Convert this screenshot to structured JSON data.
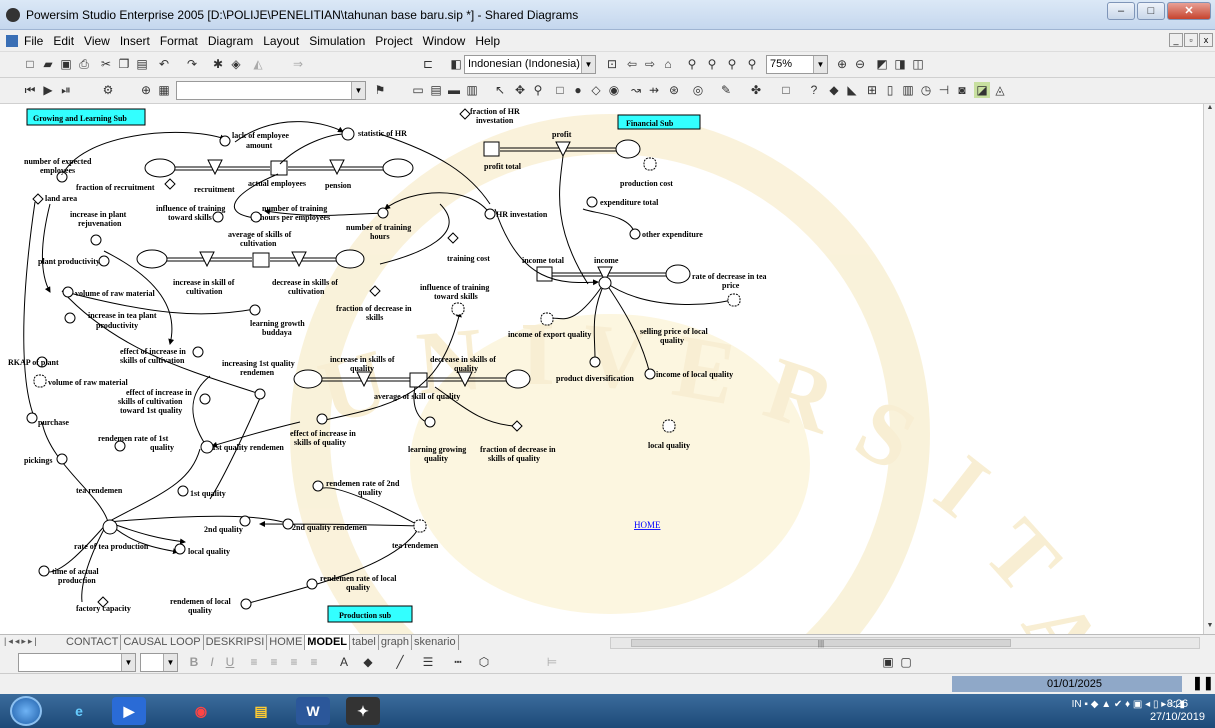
{
  "window": {
    "title": "Powersim Studio Enterprise 2005 [D:\\POLIJE\\PENELITIAN\\tahunan base baru.sip *] - Shared Diagrams"
  },
  "menu": [
    "File",
    "Edit",
    "View",
    "Insert",
    "Format",
    "Diagram",
    "Layout",
    "Simulation",
    "Project",
    "Window",
    "Help"
  ],
  "toolbar": {
    "language": "Indonesian (Indonesia)",
    "zoom": "75%"
  },
  "sectors": {
    "growing": "Growing and Learning Sub",
    "financial": "Financial Sub",
    "production": "Production sub"
  },
  "link": {
    "home": "HOME"
  },
  "labels": {
    "lack_of_employee": "lack of employee",
    "amount": "amount",
    "statistic_hr": "statistic of HR",
    "number_expected": "number of expected",
    "employees": "employees",
    "fraction_recruitment": "fraction of recruitment",
    "recruitment": "recruitment",
    "actual_employees": "actual employees",
    "pension": "pension",
    "land_area": "land area",
    "incr_plant": "increase in plant",
    "rejuvenation": "rejuvenation",
    "infl_training": "influence of training",
    "toward_skills": "toward skills",
    "num_training_hpe": "number of training",
    "hours_per_emp": "hours per employees",
    "avg_skills": "average of skills of",
    "cultivation": "cultivation",
    "num_training_hours": "number of training",
    "hours": "hours",
    "plant_productivity": "plant productivity",
    "training_cost": "training cost",
    "incr_skill_cult": "increase in skill of",
    "decr_skills": "decrease in skills of",
    "volume_raw": "volume of raw material",
    "incr_tea_plant": "increase in tea plant",
    "productivity": "productivity",
    "frac_decr_skills": "fraction of decrease in",
    "skills": "skills",
    "learning_growth": "learning growth",
    "buddaya": "buddaya",
    "effect_incr_skills": "effect of increase in",
    "skills_cult": "skills of cultivation",
    "rkap": "RKAP of plant",
    "increasing_1st": "increasing 1st quality",
    "rendemen": "rendemen",
    "volume_raw2": "volume of raw material",
    "effect_incr_skills2": "effect of increase in",
    "skills_cult2": "skills of cultivation",
    "toward_1st": "toward 1st quality",
    "purchase": "purchase",
    "rendemen_rate_1st": "rendemen rate of 1st",
    "quality": "quality",
    "pickings": "pickings",
    "first_quality_rendemen": "1st quality rendemen",
    "tea_rendemen": "tea rendemen",
    "first_quality": "1st quality",
    "rendemen_rate_2nd": "rendemen rate of 2nd",
    "quality2": "quality",
    "second_quality": "2nd quality",
    "second_quality_rendemen": "2nd quality rendemen",
    "tea_rendemen2": "tea rendemen",
    "rate_tea_prod": "rate of tea production",
    "local_quality": "local quality",
    "time_actual": "time of actual",
    "production": "production",
    "rendemen_rate_local": "rendemen rate of local",
    "quality3": "quality",
    "rendemen_local": "rendemen of local",
    "quality4": "quality",
    "factory_capacity": "factory capacity",
    "frac_hr_invest": "fraction of HR",
    "investation": "investation",
    "profit": "profit",
    "profit_total": "profit total",
    "production_cost": "production cost",
    "expenditure_total": "expenditure total",
    "hr_investation": "HR investation",
    "other_expenditure": "other expenditure",
    "income_total": "income total",
    "income": "income",
    "rate_decr_tea": "rate of decrease in tea",
    "price": "price",
    "infl_training2": "influence of training",
    "toward_skills2": "toward skills",
    "income_export": "income of export quality",
    "selling_price": "selling price of local",
    "quality5": "quality",
    "incr_skills_quality": "increase in skills of",
    "quality6": "quality",
    "decr_skills_quality": "decrease in skills of",
    "quality7": "quality",
    "product_div": "product diversification",
    "income_local": "income of local quality",
    "avg_skill_quality": "average of skill of quality",
    "effect_incr_skills_q": "effect of increase in",
    "skills_quality": "skills of quality",
    "learning_growing": "learning growing",
    "quality8": "quality",
    "frac_decr_skills_q": "fraction of decrease in",
    "skills_quality2": "skills of quality",
    "local_quality2": "local quality"
  },
  "sheet_tabs": [
    "CONTACT",
    "CAUSAL LOOP",
    "DESKRIPSI",
    "HOME",
    "MODEL",
    "tabel",
    "graph",
    "skenario"
  ],
  "active_tab": "MODEL",
  "status": {
    "date": "01/01/2025"
  },
  "taskbar": {
    "lang": "IN",
    "time": "8:26",
    "date": "27/10/2019"
  }
}
